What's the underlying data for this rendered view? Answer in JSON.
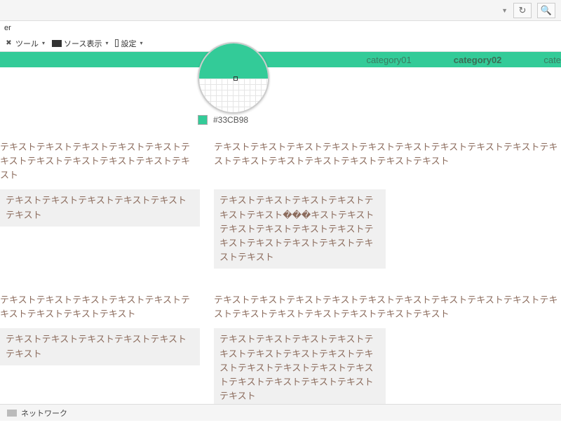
{
  "browser": {
    "dropdown_glyph": "▼",
    "reload_glyph": "↻",
    "search_glyph": "🔍"
  },
  "panel": {
    "title_suffix": "er"
  },
  "toolbar": {
    "tools": {
      "label": "ツール",
      "icon": "✖"
    },
    "sourceview": {
      "label": "ソース表示",
      "icon": "▭"
    },
    "settings": {
      "label": "設定",
      "icon": "▯"
    }
  },
  "nav": {
    "tabs": [
      {
        "label": "category01",
        "active": false
      },
      {
        "label": "category02",
        "active": true
      },
      {
        "label": "cate",
        "active": false
      }
    ]
  },
  "colorpicker": {
    "hex": "#33CB98"
  },
  "blocks": [
    {
      "left_plain": "テキストテキストテキストテキストテキストテキストテキストテキストテキストテキストテキスト",
      "right_plain": "テキストテキストテキストテキストテキストテキストテキストテキストテキストテキストテキストテキストテキストテキストテキストテキスト",
      "left_grey": "テキストテキストテキストテキストテキストテキスト",
      "right_grey": "テキストテキストテキストテキストテキストテキスト���キストテキストテキストテキストテキストテキストテキストテキストテキストテキストテキストテキスト"
    },
    {
      "left_plain": "テキストテキストテキストテキストテキストテキストテキストテキストテキスト",
      "right_plain": "テキストテキストテキストテキストテキストテキストテキストテキストテキストテキストテキストテキストテキストテキストテキストテキスト",
      "left_grey": "テキストテキストテキストテキストテキストテキスト",
      "right_grey": "テキストテキストテキストテキストテキストテキストテキストテキストテキストテキストテキストテキストテキストテキストテキストテキストテキストテキスト"
    }
  ],
  "bottombar": {
    "network_label": "ネットワーク"
  }
}
